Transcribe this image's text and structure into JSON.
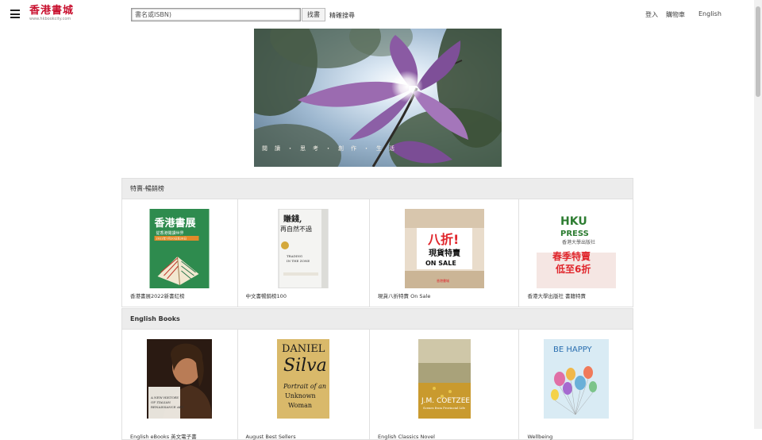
{
  "header": {
    "logo_text": "香港書城",
    "logo_subtext": "www.hkbookcity.com",
    "search_placeholder": "書名或ISBN)",
    "search_button": "找書",
    "advanced_search": "精確搜尋",
    "login": "登入",
    "cart": "購物車",
    "language": "English"
  },
  "hero": {
    "caption": "閱讀・思考・創作・生活"
  },
  "sections": [
    {
      "title": "特賣-暢銷榜",
      "items": [
        {
          "label": "香港書展2022新書紅榜",
          "cover_text": "香港書展",
          "cover_sub": "從香港閱讀世界",
          "cover_date": "2022年7月20日至26日"
        },
        {
          "label": "中文書暢銷榜100",
          "cover_text": "賺錢，再自然不過",
          "cover_sub": "TRADING IN THE ZONE"
        },
        {
          "label": "現貨八折特賣 On Sale",
          "cover_text": "八折!",
          "cover_sub": "現貨特賣",
          "cover_tag": "ON SALE",
          "cover_brand": "香港書城"
        },
        {
          "label": "香港大學出版社 書籍特賣",
          "cover_logo1": "HKU",
          "cover_logo2": "PRESS",
          "cover_sub": "香港大學出版社",
          "cover_text": "春季特賣",
          "cover_tag": "低至6折"
        }
      ]
    },
    {
      "title": "English Books",
      "items": [
        {
          "label": "English eBooks 英文電子書",
          "cover_text": "A NEW HISTORY OF ITALIAN RENAISSANCE ART"
        },
        {
          "label": "August Best Sellers",
          "cover_author1": "DANIEL",
          "cover_author2": "Silva",
          "cover_title": "Portrait of an Unknown Woman"
        },
        {
          "label": "English Classics Novel",
          "cover_author": "J.M. COETZEE",
          "cover_title": "Scenes from Provincial Life"
        },
        {
          "label": "Wellbeing",
          "cover_text": "BE HAPPY"
        }
      ]
    }
  ]
}
